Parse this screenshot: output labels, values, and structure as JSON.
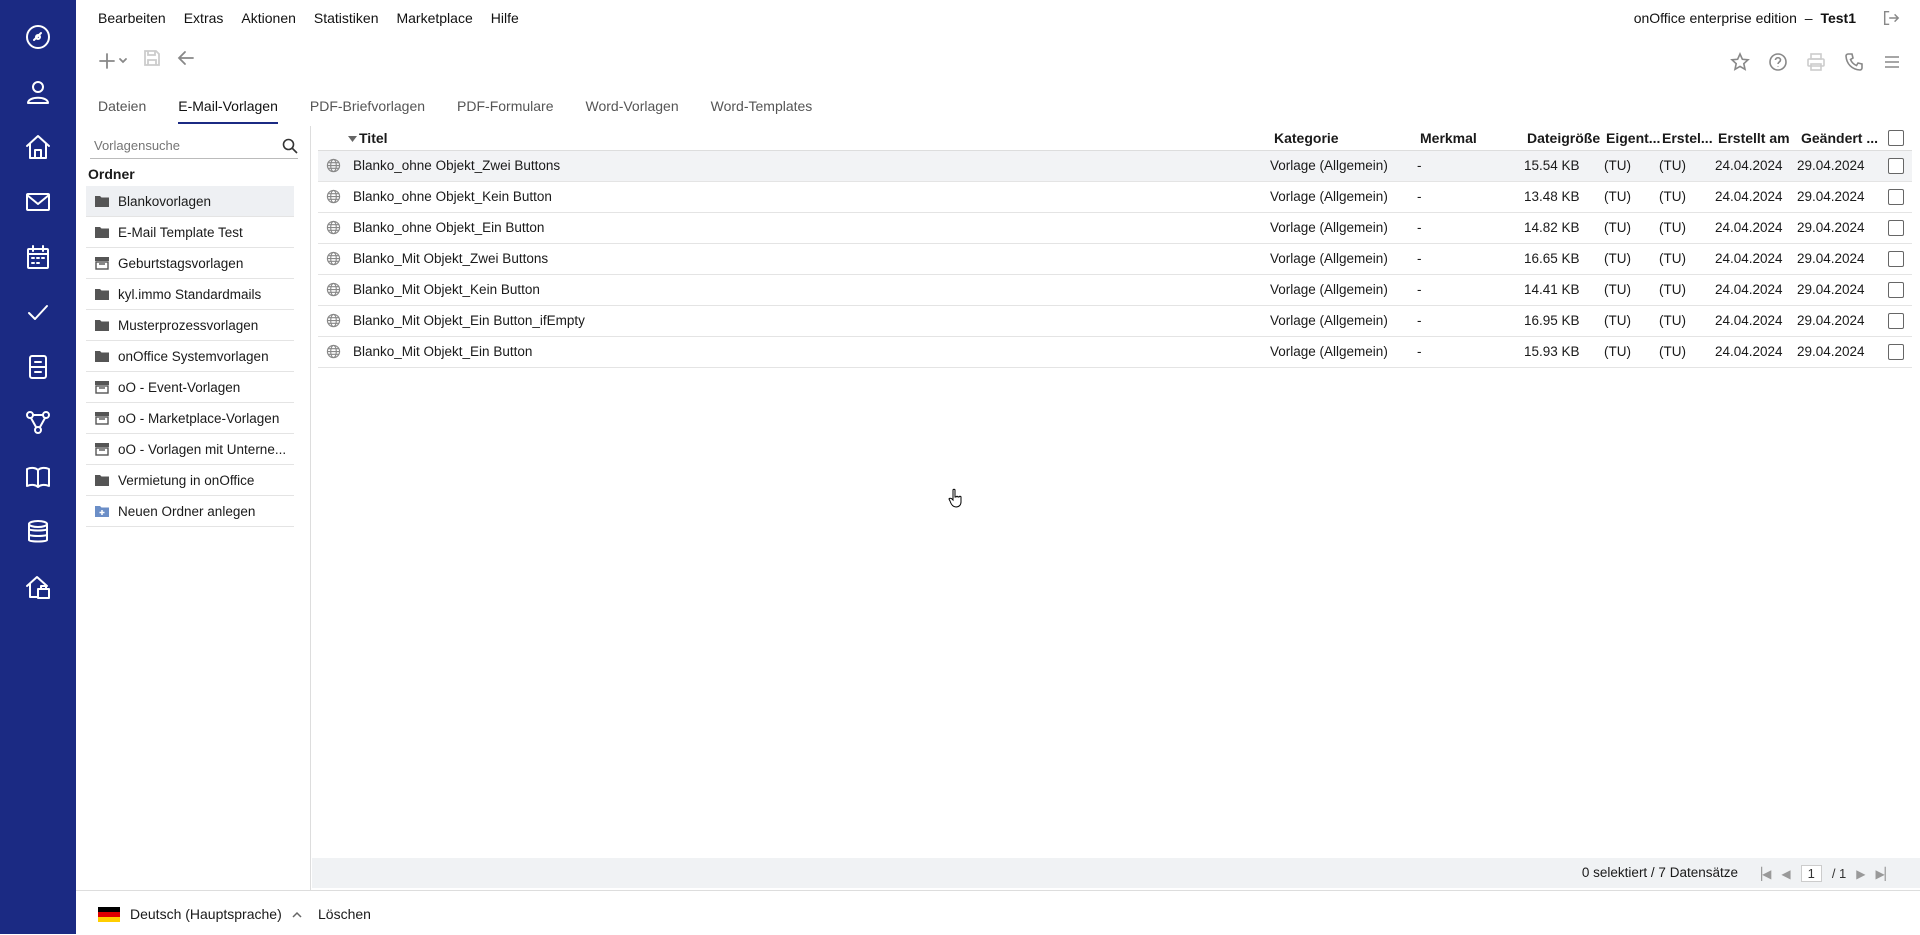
{
  "menu": [
    "Bearbeiten",
    "Extras",
    "Aktionen",
    "Statistiken",
    "Marketplace",
    "Hilfe"
  ],
  "edition": "onOffice enterprise edition",
  "user_sep": "–",
  "user": "Test1",
  "tabs": [
    "Dateien",
    "E-Mail-Vorlagen",
    "PDF-Briefvorlagen",
    "PDF-Formulare",
    "Word-Vorlagen",
    "Word-Templates"
  ],
  "active_tab": "E-Mail-Vorlagen",
  "sidebar": {
    "search_placeholder": "Vorlagensuche",
    "folder_heading": "Ordner",
    "folders": [
      {
        "label": "Blankovorlagen",
        "icon": "folder-icon"
      },
      {
        "label": "E-Mail Template Test",
        "icon": "folder-icon"
      },
      {
        "label": "Geburtstagsvorlagen",
        "icon": "archive-folder-icon"
      },
      {
        "label": "kyl.immo Standardmails",
        "icon": "folder-icon"
      },
      {
        "label": "Musterprozessvorlagen",
        "icon": "folder-icon"
      },
      {
        "label": "onOffice Systemvorlagen",
        "icon": "folder-icon"
      },
      {
        "label": "oO - Event-Vorlagen",
        "icon": "archive-folder-icon"
      },
      {
        "label": "oO - Marketplace-Vorlagen",
        "icon": "archive-folder-icon"
      },
      {
        "label": "oO - Vorlagen mit Unterne...",
        "icon": "archive-folder-icon"
      },
      {
        "label": "Vermietung in onOffice",
        "icon": "folder-icon"
      },
      {
        "label": "Neuen Ordner anlegen",
        "icon": "add-folder-icon"
      }
    ]
  },
  "columns": {
    "titel": "Titel",
    "kategorie": "Kategorie",
    "merkmal": "Merkmal",
    "groesse": "Dateigröße",
    "eigent": "Eigent...",
    "erstell": "Erstel...",
    "erstellt_am": "Erstellt am",
    "geaendert": "Geändert ..."
  },
  "rows": [
    {
      "titel": "Blanko_ohne Objekt_Zwei Buttons",
      "kategorie": "Vorlage (Allgemein)",
      "merkmal": "-",
      "groesse": "15.54 KB",
      "eigent": "(TU)",
      "erstell": "(TU)",
      "erstellt_am": "24.04.2024",
      "geaendert": "29.04.2024"
    },
    {
      "titel": "Blanko_ohne Objekt_Kein Button",
      "kategorie": "Vorlage (Allgemein)",
      "merkmal": "-",
      "groesse": "13.48 KB",
      "eigent": "(TU)",
      "erstell": "(TU)",
      "erstellt_am": "24.04.2024",
      "geaendert": "29.04.2024"
    },
    {
      "titel": "Blanko_ohne Objekt_Ein Button",
      "kategorie": "Vorlage (Allgemein)",
      "merkmal": "-",
      "groesse": "14.82 KB",
      "eigent": "(TU)",
      "erstell": "(TU)",
      "erstellt_am": "24.04.2024",
      "geaendert": "29.04.2024"
    },
    {
      "titel": "Blanko_Mit Objekt_Zwei Buttons",
      "kategorie": "Vorlage (Allgemein)",
      "merkmal": "-",
      "groesse": "16.65 KB",
      "eigent": "(TU)",
      "erstell": "(TU)",
      "erstellt_am": "24.04.2024",
      "geaendert": "29.04.2024"
    },
    {
      "titel": "Blanko_Mit Objekt_Kein Button",
      "kategorie": "Vorlage (Allgemein)",
      "merkmal": "-",
      "groesse": "14.41 KB",
      "eigent": "(TU)",
      "erstell": "(TU)",
      "erstellt_am": "24.04.2024",
      "geaendert": "29.04.2024"
    },
    {
      "titel": "Blanko_Mit Objekt_Ein Button_ifEmpty",
      "kategorie": "Vorlage (Allgemein)",
      "merkmal": "-",
      "groesse": "16.95 KB",
      "eigent": "(TU)",
      "erstell": "(TU)",
      "erstellt_am": "24.04.2024",
      "geaendert": "29.04.2024"
    },
    {
      "titel": "Blanko_Mit Objekt_Ein Button",
      "kategorie": "Vorlage (Allgemein)",
      "merkmal": "-",
      "groesse": "15.93 KB",
      "eigent": "(TU)",
      "erstell": "(TU)",
      "erstellt_am": "24.04.2024",
      "geaendert": "29.04.2024"
    }
  ],
  "pager": {
    "count_text": "0 selektiert / 7 Datensätze",
    "current_page": "1",
    "total_pages": "/ 1"
  },
  "footer": {
    "language": "Deutsch (Hauptsprache)",
    "delete": "Löschen"
  },
  "colors": {
    "rail": "#1b2a83",
    "active_tab_underline": "#1b2a83"
  }
}
